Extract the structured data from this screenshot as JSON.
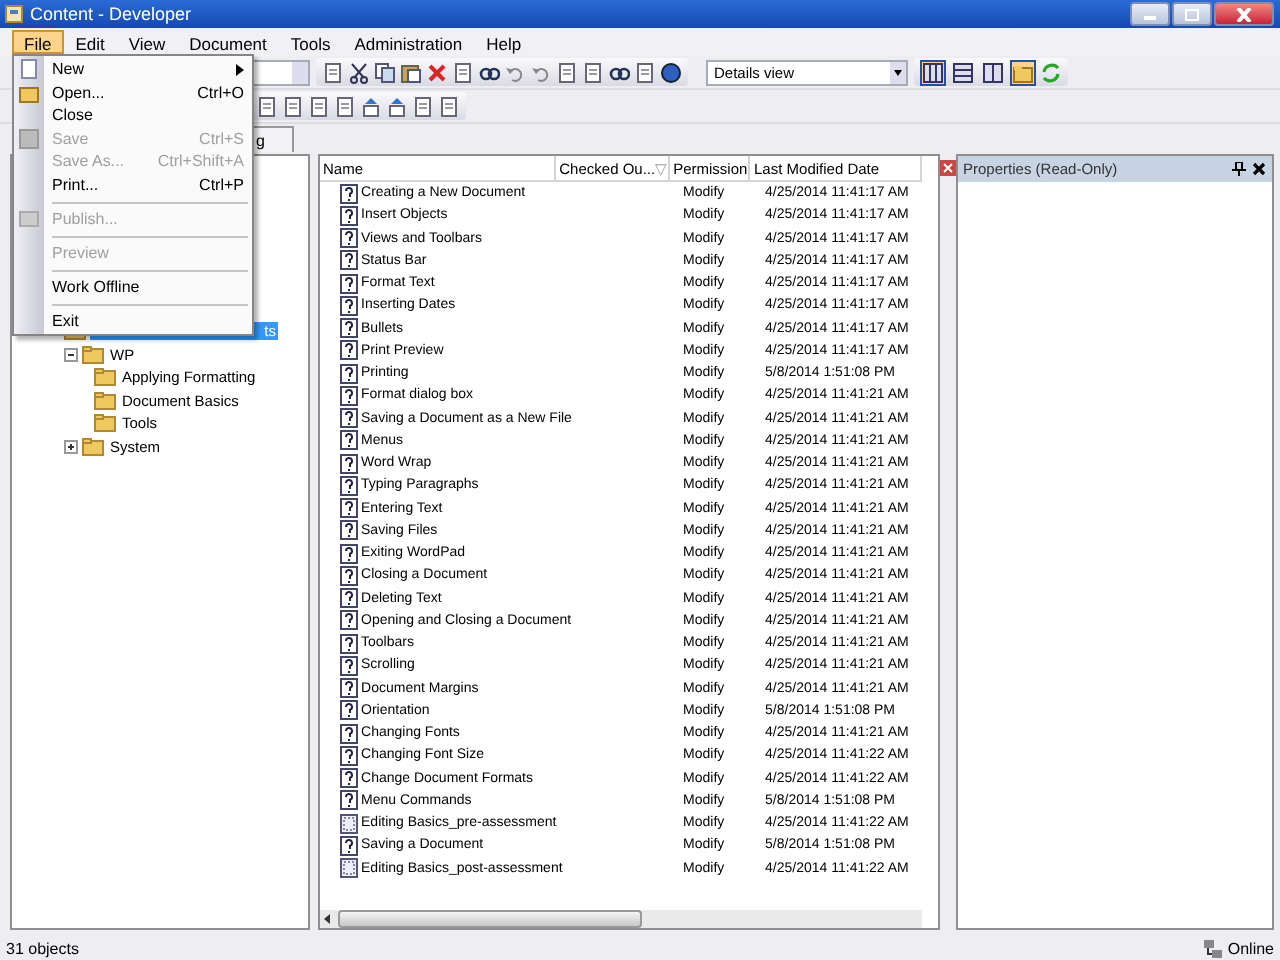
{
  "window": {
    "title": "Content - Developer"
  },
  "menu_bar": [
    {
      "label": "File",
      "selected": true
    },
    {
      "label": "Edit",
      "selected": false
    },
    {
      "label": "View",
      "selected": false
    },
    {
      "label": "Document",
      "selected": false
    },
    {
      "label": "Tools",
      "selected": false
    },
    {
      "label": "Administration",
      "selected": false
    },
    {
      "label": "Help",
      "selected": false
    }
  ],
  "file_menu": [
    {
      "kind": "item",
      "label": "New",
      "submenu": true,
      "disabled": false
    },
    {
      "kind": "item",
      "label": "Open...",
      "shortcut": "Ctrl+O",
      "disabled": false
    },
    {
      "kind": "item",
      "label": "Close",
      "disabled": false
    },
    {
      "kind": "item",
      "label": "Save",
      "shortcut": "Ctrl+S",
      "disabled": true
    },
    {
      "kind": "item",
      "label": "Save As...",
      "shortcut": "Ctrl+Shift+A",
      "disabled": true
    },
    {
      "kind": "item",
      "label": "Print...",
      "shortcut": "Ctrl+P",
      "disabled": false
    },
    {
      "kind": "separator"
    },
    {
      "kind": "item",
      "label": "Publish...",
      "disabled": true
    },
    {
      "kind": "separator"
    },
    {
      "kind": "item",
      "label": "Preview",
      "disabled": true
    },
    {
      "kind": "separator"
    },
    {
      "kind": "item",
      "label": "Work Offline",
      "disabled": false
    },
    {
      "kind": "separator"
    },
    {
      "kind": "item",
      "label": "Exit",
      "disabled": false
    }
  ],
  "toolbar": {
    "view_select": {
      "value": "Details view"
    },
    "tab": {
      "label": "g"
    }
  },
  "tree": [
    {
      "label": "ts",
      "selected": true
    },
    {
      "label": "WP",
      "selected": false,
      "expanded": true,
      "children": [
        {
          "label": "Applying Formatting",
          "selected": false
        },
        {
          "label": "Document Basics",
          "selected": false
        },
        {
          "label": "Tools",
          "selected": false
        }
      ]
    },
    {
      "label": "System",
      "selected": false,
      "expanded": false
    }
  ],
  "table": {
    "columns": [
      "Name",
      "Checked Ou...",
      "Permission",
      "Last Modified Date"
    ],
    "sort_mark": "▽",
    "rows": [
      {
        "kind": "topic",
        "name": "Creating a New Document",
        "permission": "Modify",
        "modified": "4/25/2014 11:41:17 AM"
      },
      {
        "kind": "topic",
        "name": "Insert Objects",
        "permission": "Modify",
        "modified": "4/25/2014 11:41:17 AM"
      },
      {
        "kind": "topic",
        "name": "Views and Toolbars",
        "permission": "Modify",
        "modified": "4/25/2014 11:41:17 AM"
      },
      {
        "kind": "topic",
        "name": "Status Bar",
        "permission": "Modify",
        "modified": "4/25/2014 11:41:17 AM"
      },
      {
        "kind": "topic",
        "name": "Format Text",
        "permission": "Modify",
        "modified": "4/25/2014 11:41:17 AM"
      },
      {
        "kind": "topic",
        "name": "Inserting Dates",
        "permission": "Modify",
        "modified": "4/25/2014 11:41:17 AM"
      },
      {
        "kind": "topic",
        "name": "Bullets",
        "permission": "Modify",
        "modified": "4/25/2014 11:41:17 AM"
      },
      {
        "kind": "topic",
        "name": "Print Preview",
        "permission": "Modify",
        "modified": "4/25/2014 11:41:17 AM"
      },
      {
        "kind": "topic",
        "name": "Printing",
        "permission": "Modify",
        "modified": "5/8/2014 1:51:08 PM"
      },
      {
        "kind": "topic",
        "name": "Format dialog box",
        "permission": "Modify",
        "modified": "4/25/2014 11:41:21 AM"
      },
      {
        "kind": "topic",
        "name": "Saving a Document as a New File",
        "permission": "Modify",
        "modified": "4/25/2014 11:41:21 AM"
      },
      {
        "kind": "topic",
        "name": "Menus",
        "permission": "Modify",
        "modified": "4/25/2014 11:41:21 AM"
      },
      {
        "kind": "topic",
        "name": "Word Wrap",
        "permission": "Modify",
        "modified": "4/25/2014 11:41:21 AM"
      },
      {
        "kind": "topic",
        "name": "Typing Paragraphs",
        "permission": "Modify",
        "modified": "4/25/2014 11:41:21 AM"
      },
      {
        "kind": "topic",
        "name": "Entering Text",
        "permission": "Modify",
        "modified": "4/25/2014 11:41:21 AM"
      },
      {
        "kind": "topic",
        "name": "Saving Files",
        "permission": "Modify",
        "modified": "4/25/2014 11:41:21 AM"
      },
      {
        "kind": "topic",
        "name": "Exiting WordPad",
        "permission": "Modify",
        "modified": "4/25/2014 11:41:21 AM"
      },
      {
        "kind": "topic",
        "name": "Closing a Document",
        "permission": "Modify",
        "modified": "4/25/2014 11:41:21 AM"
      },
      {
        "kind": "topic",
        "name": "Deleting Text",
        "permission": "Modify",
        "modified": "4/25/2014 11:41:21 AM"
      },
      {
        "kind": "topic",
        "name": "Opening and Closing a Document",
        "permission": "Modify",
        "modified": "4/25/2014 11:41:21 AM"
      },
      {
        "kind": "topic",
        "name": "Toolbars",
        "permission": "Modify",
        "modified": "4/25/2014 11:41:21 AM"
      },
      {
        "kind": "topic",
        "name": "Scrolling",
        "permission": "Modify",
        "modified": "4/25/2014 11:41:21 AM"
      },
      {
        "kind": "topic",
        "name": "Document Margins",
        "permission": "Modify",
        "modified": "4/25/2014 11:41:21 AM"
      },
      {
        "kind": "topic",
        "name": "Orientation",
        "permission": "Modify",
        "modified": "5/8/2014 1:51:08 PM"
      },
      {
        "kind": "topic",
        "name": "Changing Fonts",
        "permission": "Modify",
        "modified": "4/25/2014 11:41:21 AM"
      },
      {
        "kind": "topic",
        "name": "Changing Font Size",
        "permission": "Modify",
        "modified": "4/25/2014 11:41:22 AM"
      },
      {
        "kind": "topic",
        "name": "Change Document Formats",
        "permission": "Modify",
        "modified": "4/25/2014 11:41:22 AM"
      },
      {
        "kind": "topic",
        "name": "Menu Commands",
        "permission": "Modify",
        "modified": "5/8/2014 1:51:08 PM"
      },
      {
        "kind": "assessment",
        "name": "Editing Basics_pre-assessment",
        "permission": "Modify",
        "modified": "4/25/2014 11:41:22 AM"
      },
      {
        "kind": "topic",
        "name": "Saving a Document",
        "permission": "Modify",
        "modified": "5/8/2014 1:51:08 PM"
      },
      {
        "kind": "assessment",
        "name": "Editing Basics_post-assessment",
        "permission": "Modify",
        "modified": "4/25/2014 11:41:22 AM"
      }
    ]
  },
  "properties_panel": {
    "title": "Properties (Read-Only)"
  },
  "status_bar": {
    "count": "31 objects",
    "connection": "Online"
  }
}
